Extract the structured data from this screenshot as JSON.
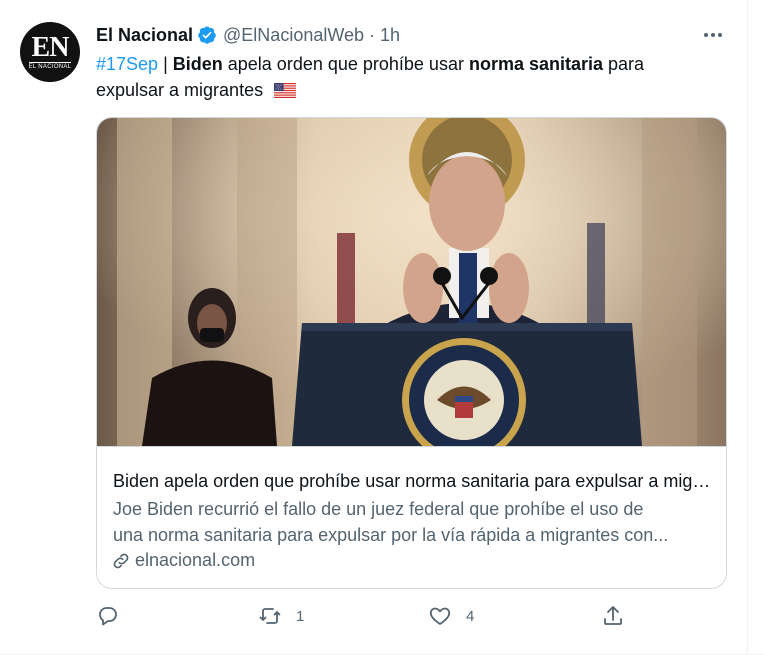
{
  "tweet": {
    "author_name": "El Nacional",
    "avatar_monogram": "EN",
    "avatar_subtext": "EL NACIONAL",
    "handle": "@ElNacionalWeb",
    "separator": "·",
    "time": "1h",
    "text": {
      "hashtag": "#17Sep",
      "pipe": " | ",
      "bold1": "Biden",
      "plain1": " apela orden que prohíbe usar ",
      "bold2": "norma sanitaria",
      "plain2": " para expulsar a migrantes"
    },
    "flag_icon": "us-flag-emoji"
  },
  "card": {
    "title": "Biden apela orden que prohíbe usar norma sanitaria para expulsar a migrantes",
    "description_line1": "Joe Biden recurrió el fallo de un juez federal que prohíbe el uso de",
    "description_line2": "una norma sanitaria para expulsar por la vía rápida a migrantes con...",
    "domain": "elnacional.com",
    "image_seal_text": "PRESIDENT OF THE UNITED STATES"
  },
  "actions": {
    "reply_count": "",
    "retweet_count": "1",
    "like_count": "4"
  },
  "colors": {
    "accent": "#1d9bf0",
    "muted": "#536471",
    "border": "#cfd9de"
  }
}
